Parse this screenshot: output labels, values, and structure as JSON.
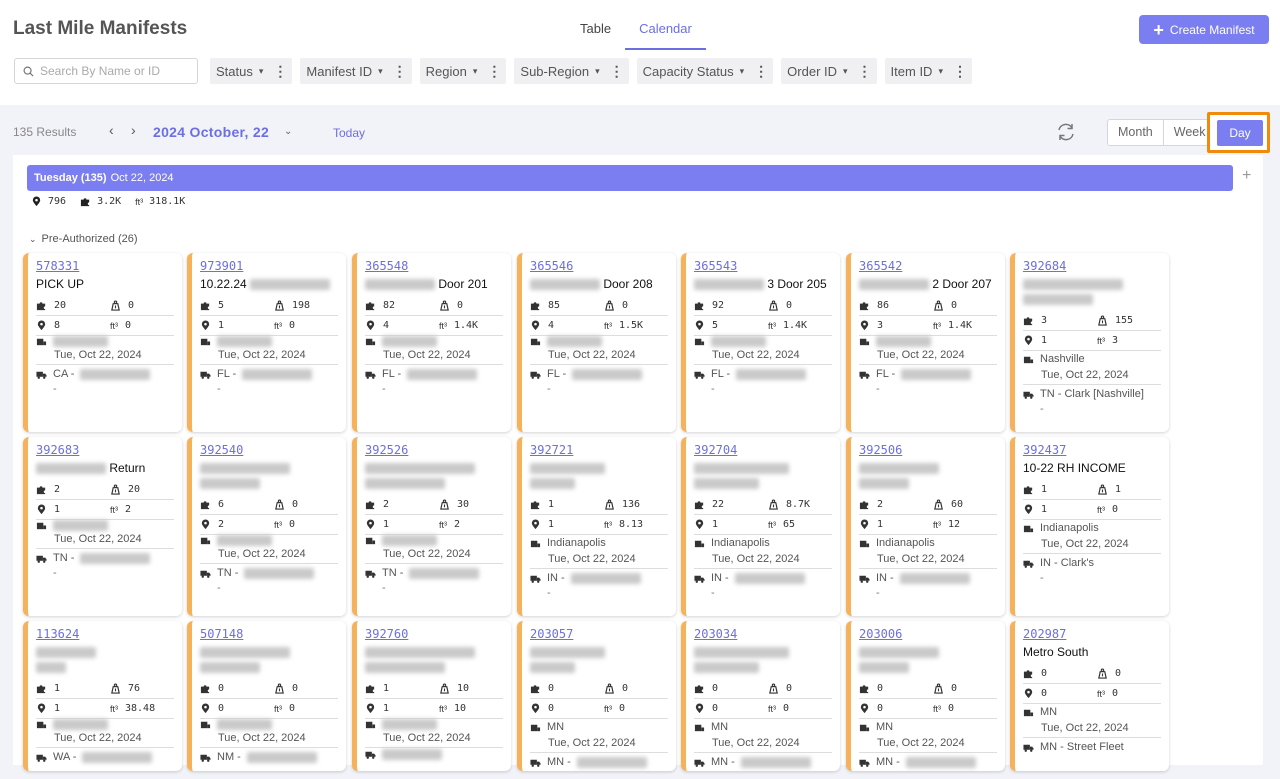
{
  "header": {
    "title": "Last Mile Manifests",
    "tabs": [
      "Table",
      "Calendar"
    ],
    "active_tab": "Calendar",
    "create_label": "Create Manifest"
  },
  "search": {
    "placeholder": "Search By Name or ID"
  },
  "filters": [
    "Status",
    "Manifest ID",
    "Region",
    "Sub-Region",
    "Capacity Status",
    "Order ID",
    "Item ID"
  ],
  "toolbar": {
    "results": "135 Results",
    "date": "2024 October, 22",
    "today": "Today",
    "views": [
      "Month",
      "Week",
      "Day"
    ],
    "active_view": "Day"
  },
  "day": {
    "label": "Tuesday (135)",
    "date": "Oct 22, 2024",
    "stats": {
      "stops": "796",
      "items": "3.2K",
      "volume": "318.1K"
    },
    "group": "Pre-Authorized (26)"
  },
  "units": {
    "ft": "ft³"
  },
  "cards": [
    {
      "id": "578331",
      "name": "PICK UP",
      "items": "20",
      "weight": "0",
      "stops": "8",
      "vol": "0",
      "origin": "",
      "date": "Tue, Oct 22, 2024",
      "carrier": "CA - ",
      "extra": "-"
    },
    {
      "id": "973901",
      "name": "10.22.24 ",
      "items": "5",
      "weight": "198",
      "stops": "1",
      "vol": "0",
      "origin": "",
      "date": "Tue, Oct 22, 2024",
      "carrier": "FL - ",
      "extra": "-"
    },
    {
      "id": "365548",
      "name": " Door 201",
      "items": "82",
      "weight": "0",
      "stops": "4",
      "vol": "1.4K",
      "origin": "",
      "date": "Tue, Oct 22, 2024",
      "carrier": "FL - ",
      "extra": "-"
    },
    {
      "id": "365546",
      "name": " Door 208",
      "items": "85",
      "weight": "0",
      "stops": "4",
      "vol": "1.5K",
      "origin": "",
      "date": "Tue, Oct 22, 2024",
      "carrier": "FL - ",
      "extra": "-"
    },
    {
      "id": "365543",
      "name": " 3 Door 205",
      "items": "92",
      "weight": "0",
      "stops": "5",
      "vol": "1.4K",
      "origin": "",
      "date": "Tue, Oct 22, 2024",
      "carrier": "FL - ",
      "extra": "-"
    },
    {
      "id": "365542",
      "name": " 2 Door 207",
      "items": "86",
      "weight": "0",
      "stops": "3",
      "vol": "1.4K",
      "origin": "",
      "date": "Tue, Oct 22, 2024",
      "carrier": "FL - ",
      "extra": "-"
    },
    {
      "id": "392684",
      "name": "",
      "items": "3",
      "weight": "155",
      "stops": "1",
      "vol": "3",
      "origin": "Nashville",
      "date": "Tue, Oct 22, 2024",
      "carrier": "TN - Clark [Nashville]",
      "extra": "-"
    },
    {
      "id": "392683",
      "name": " Return",
      "items": "2",
      "weight": "20",
      "stops": "1",
      "vol": "2",
      "origin": "",
      "date": "Tue, Oct 22, 2024",
      "carrier": "TN - ",
      "extra": "-"
    },
    {
      "id": "392540",
      "name": "",
      "items": "6",
      "weight": "0",
      "stops": "2",
      "vol": "0",
      "origin": "",
      "date": "Tue, Oct 22, 2024",
      "carrier": "TN - ",
      "extra": "-"
    },
    {
      "id": "392526",
      "name": "",
      "items": "2",
      "weight": "30",
      "stops": "1",
      "vol": "2",
      "origin": "",
      "date": "Tue, Oct 22, 2024",
      "carrier": "TN - ",
      "extra": "-"
    },
    {
      "id": "392721",
      "name": "",
      "items": "1",
      "weight": "136",
      "stops": "1",
      "vol": "8.13",
      "origin": "Indianapolis",
      "date": "Tue, Oct 22, 2024",
      "carrier": "IN - ",
      "extra": "-"
    },
    {
      "id": "392704",
      "name": "",
      "items": "22",
      "weight": "8.7K",
      "stops": "1",
      "vol": "65",
      "origin": "Indianapolis",
      "date": "Tue, Oct 22, 2024",
      "carrier": "IN - ",
      "extra": "-"
    },
    {
      "id": "392506",
      "name": "",
      "items": "2",
      "weight": "60",
      "stops": "1",
      "vol": "12",
      "origin": "Indianapolis",
      "date": "Tue, Oct 22, 2024",
      "carrier": "IN - ",
      "extra": "-"
    },
    {
      "id": "392437",
      "name": "10-22 RH INCOME",
      "items": "1",
      "weight": "1",
      "stops": "1",
      "vol": "0",
      "origin": "Indianapolis",
      "date": "Tue, Oct 22, 2024",
      "carrier": "IN - Clark's",
      "extra": "-"
    },
    {
      "id": "113624",
      "name": "",
      "items": "1",
      "weight": "76",
      "stops": "1",
      "vol": "38.48",
      "origin": "",
      "date": "Tue, Oct 22, 2024",
      "carrier": "WA - ",
      "extra": ""
    },
    {
      "id": "507148",
      "name": "",
      "items": "0",
      "weight": "0",
      "stops": "0",
      "vol": "0",
      "origin": "",
      "date": "Tue, Oct 22, 2024",
      "carrier": "NM - ",
      "extra": ""
    },
    {
      "id": "392760",
      "name": "",
      "items": "1",
      "weight": "10",
      "stops": "1",
      "vol": "10",
      "origin": "",
      "date": "Tue, Oct 22, 2024",
      "carrier": "",
      "extra": ""
    },
    {
      "id": "203057",
      "name": "",
      "items": "0",
      "weight": "0",
      "stops": "0",
      "vol": "0",
      "origin": "MN",
      "date": "Tue, Oct 22, 2024",
      "carrier": "MN - ",
      "extra": ""
    },
    {
      "id": "203034",
      "name": "",
      "items": "0",
      "weight": "0",
      "stops": "0",
      "vol": "0",
      "origin": "MN",
      "date": "Tue, Oct 22, 2024",
      "carrier": "MN - ",
      "extra": ""
    },
    {
      "id": "203006",
      "name": "",
      "items": "0",
      "weight": "0",
      "stops": "0",
      "vol": "0",
      "origin": "MN",
      "date": "Tue, Oct 22, 2024",
      "carrier": "MN - ",
      "extra": ""
    },
    {
      "id": "202987",
      "name": "Metro South",
      "items": "0",
      "weight": "0",
      "stops": "0",
      "vol": "0",
      "origin": "MN",
      "date": "Tue, Oct 22, 2024",
      "carrier": "MN - Street Fleet",
      "extra": ""
    }
  ],
  "colors": {
    "accent": "#7b7ef0",
    "card_stripe": "#f5b25a",
    "highlight": "#f08a0a"
  },
  "icons": {
    "stops": "map-pin-icon",
    "items": "puzzle-icon",
    "weight": "weight-icon",
    "volume": "cube-icon",
    "origin": "warehouse-icon",
    "carrier": "truck-icon"
  }
}
